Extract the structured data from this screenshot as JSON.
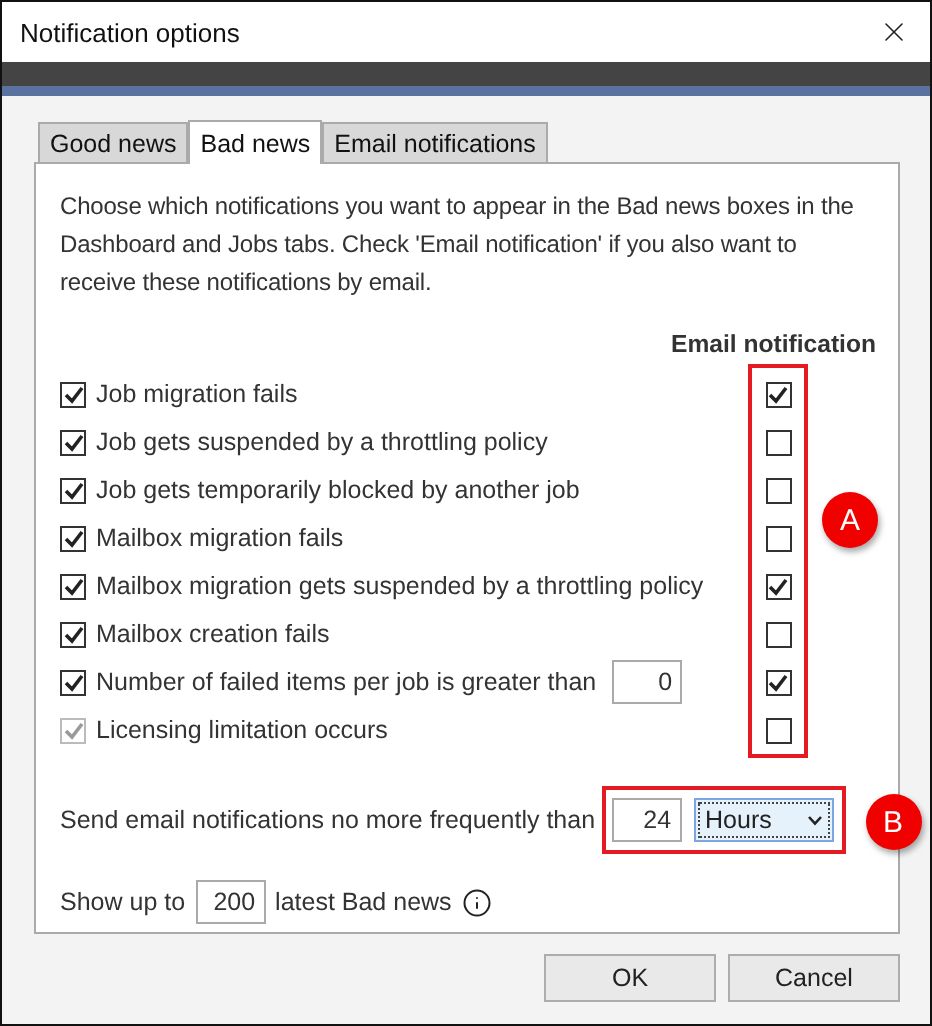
{
  "window": {
    "title": "Notification options"
  },
  "tabs": [
    {
      "label": "Good news",
      "selected": false
    },
    {
      "label": "Bad news",
      "selected": true
    },
    {
      "label": "Email notifications",
      "selected": false
    }
  ],
  "description": "Choose which notifications you want to appear in the Bad news boxes in the Dashboard and Jobs tabs. Check 'Email notification' if you also want to receive these notifications by email.",
  "email_column_header": "Email notification",
  "rules": [
    {
      "kind": "plain",
      "label": "Job migration fails",
      "checked": true,
      "disabled": false,
      "email_checked": true
    },
    {
      "kind": "plain",
      "label": "Job gets suspended by a throttling policy",
      "checked": true,
      "disabled": false,
      "email_checked": false
    },
    {
      "kind": "plain",
      "label": "Job gets temporarily blocked by another job",
      "checked": true,
      "disabled": false,
      "email_checked": false
    },
    {
      "kind": "plain",
      "label": "Mailbox migration fails",
      "checked": true,
      "disabled": false,
      "email_checked": false
    },
    {
      "kind": "plain",
      "label": "Mailbox migration gets suspended by a throttling policy",
      "checked": true,
      "disabled": false,
      "email_checked": true
    },
    {
      "kind": "plain",
      "label": "Mailbox creation fails",
      "checked": true,
      "disabled": false,
      "email_checked": false
    },
    {
      "kind": "threshold",
      "label": "Number of failed items per job is greater than",
      "value": "0",
      "checked": true,
      "disabled": false,
      "email_checked": true
    },
    {
      "kind": "plain",
      "label": "Licensing limitation occurs",
      "checked": true,
      "disabled": true,
      "email_checked": false
    }
  ],
  "frequency": {
    "label": "Send email notifications no more frequently than",
    "value": "24",
    "unit": "Hours"
  },
  "show": {
    "prefix": "Show up to",
    "value": "200",
    "suffix": "latest Bad news"
  },
  "annotations": [
    {
      "label": "A"
    },
    {
      "label": "B"
    }
  ],
  "buttons": [
    "OK",
    "Cancel"
  ]
}
